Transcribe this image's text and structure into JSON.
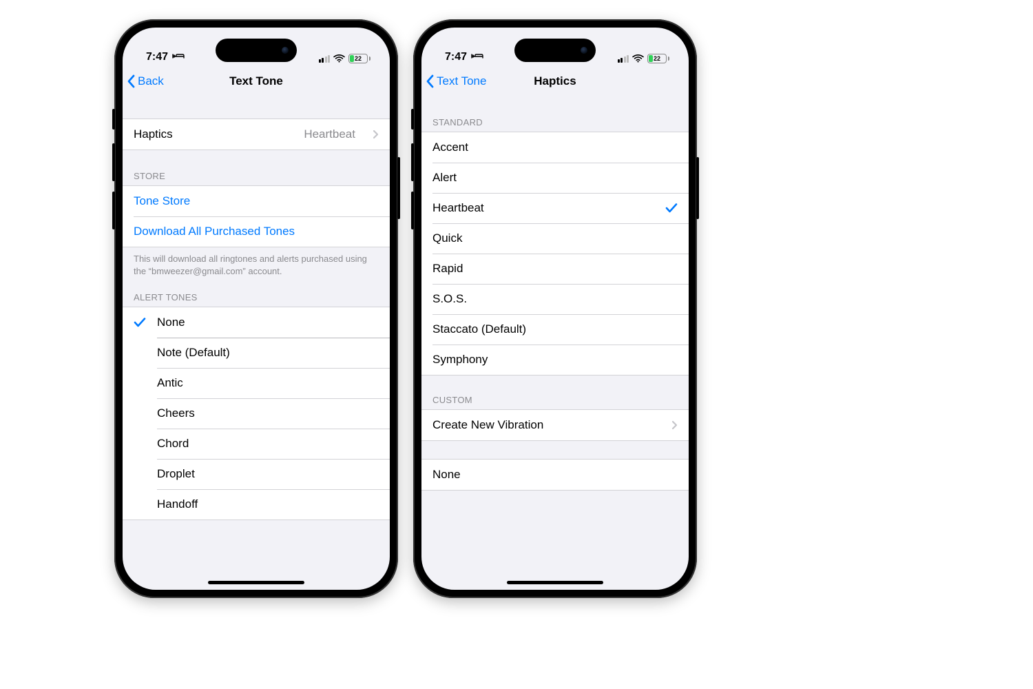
{
  "status": {
    "time": "7:47",
    "battery_percent": "22"
  },
  "left": {
    "nav": {
      "back": "Back",
      "title": "Text Tone"
    },
    "haptics_row": {
      "label": "Haptics",
      "value": "Heartbeat"
    },
    "store_header": "STORE",
    "store_items": {
      "tone_store": "Tone Store",
      "download": "Download All Purchased Tones"
    },
    "store_footer": "This will download all ringtones and alerts purchased using the “bmweezer@gmail.com” account.",
    "alert_header": "ALERT TONES",
    "alert_tones": {
      "none": "None",
      "note": "Note (Default)",
      "antic": "Antic",
      "cheers": "Cheers",
      "chord": "Chord",
      "droplet": "Droplet",
      "handoff": "Handoff"
    },
    "selected_alert_tone": "None"
  },
  "right": {
    "nav": {
      "back": "Text Tone",
      "title": "Haptics"
    },
    "standard_header": "STANDARD",
    "standard_items": {
      "accent": "Accent",
      "alert": "Alert",
      "heartbeat": "Heartbeat",
      "quick": "Quick",
      "rapid": "Rapid",
      "sos": "S.O.S.",
      "staccato": "Staccato (Default)",
      "symphony": "Symphony"
    },
    "selected_haptic": "Heartbeat",
    "custom_header": "CUSTOM",
    "custom_row": "Create New Vibration",
    "none_row": "None"
  }
}
